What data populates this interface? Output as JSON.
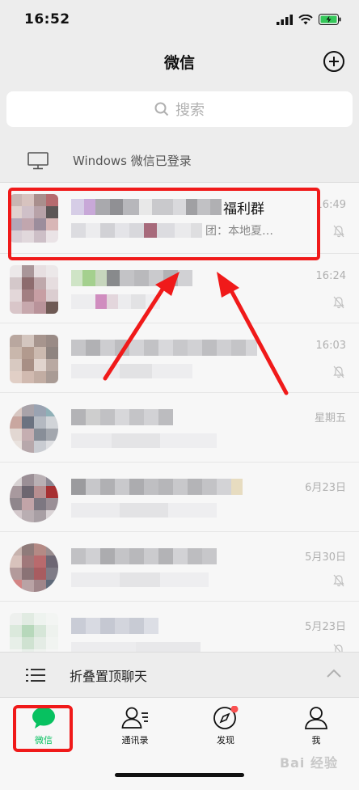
{
  "status_bar": {
    "time": "16:52"
  },
  "nav": {
    "title": "微信"
  },
  "search": {
    "placeholder": "搜索"
  },
  "login_banner": {
    "text": "Windows 微信已登录"
  },
  "chats": [
    {
      "name_visible": "福利群",
      "preview_visible": "团：本地夏…",
      "time": "16:49",
      "muted": true
    },
    {
      "name_visible": "",
      "preview_visible": "",
      "time": "16:24",
      "muted": true
    },
    {
      "name_visible": "",
      "preview_visible": "",
      "time": "16:03",
      "muted": true
    },
    {
      "name_visible": "",
      "preview_visible": "",
      "time": "星期五",
      "muted": false
    },
    {
      "name_visible": "",
      "preview_visible": "",
      "time": "6月23日",
      "muted": false
    },
    {
      "name_visible": "",
      "preview_visible": "",
      "time": "5月30日",
      "muted": true
    },
    {
      "name_visible": "",
      "preview_visible": "",
      "time": "5月23日",
      "muted": true
    }
  ],
  "fold_bar": {
    "label": "折叠置顶聊天"
  },
  "tabs": [
    {
      "label": "微信",
      "active": true
    },
    {
      "label": "通讯录",
      "active": false
    },
    {
      "label": "发现",
      "active": false,
      "badge": true
    },
    {
      "label": "我",
      "active": false
    }
  ],
  "watermark": "Bai 经验",
  "colors": {
    "accent": "#07c160",
    "highlight": "#f01a1a",
    "badge": "#fa5151"
  }
}
